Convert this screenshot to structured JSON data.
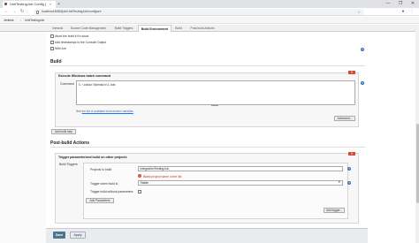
{
  "browser": {
    "tab_title": "UnitTestingJob Config [",
    "tab_close": "×",
    "new_tab": "+",
    "url": "localhost:8080/job/UnitTestingJob/configure",
    "window_controls": [
      "—",
      "❐",
      "✕"
    ]
  },
  "breadcrumbs": [
    "Jenkins",
    "UnitTestingJob"
  ],
  "config_tabs": [
    "General",
    "Source Code Management",
    "Build Triggers",
    "Build Environment",
    "Build",
    "Post-build Actions"
  ],
  "build_environment": {
    "options": [
      "Abort the build if it's stuck",
      "Add timestamps to the Console Output",
      "With Ant"
    ]
  },
  "build": {
    "title": "Build",
    "step_title": "Execute Windows batch command",
    "command_label": "Command",
    "command_value": "C:\\cabin\\Openwin\\1.bat",
    "env_note_prefix": "See ",
    "env_note_link": "the list of available environment variables",
    "advanced_button": "Advanced...",
    "add_step_button": "Add build step"
  },
  "post_build": {
    "title": "Post-build Actions",
    "step_title": "Trigger parameterized build on other projects",
    "build_triggers_label": "Build Triggers",
    "projects_label": "Projects to build",
    "projects_value": "IntegrationTestingJob,",
    "error_message": "Blank project name in the list",
    "trigger_when_label": "Trigger when build is",
    "trigger_when_value": "Stable",
    "trigger_without_params_label": "Trigger build without parameters",
    "add_parameters_button": "Add Parameters",
    "add_trigger_button": "Add trigger...",
    "x_label": "X"
  },
  "footer": {
    "save": "Save",
    "apply": "Apply"
  },
  "colors": {
    "delete_red": "#d24939",
    "save_blue": "#4b758b",
    "help_blue": "#3b6fb6"
  }
}
